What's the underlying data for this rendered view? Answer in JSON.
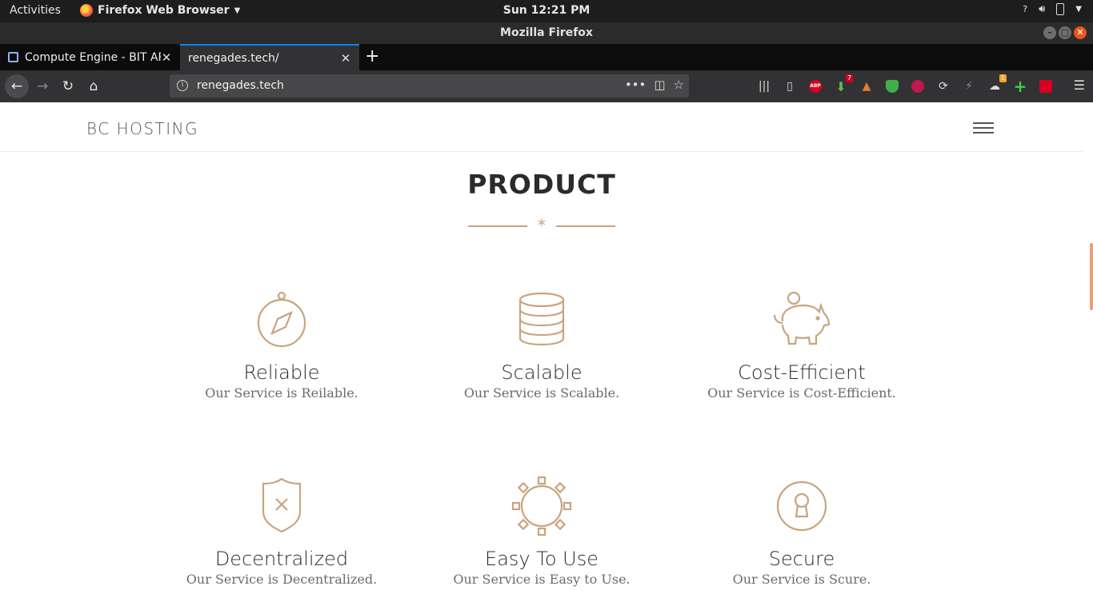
{
  "system_bar": {
    "activities": "Activities",
    "app_name": "Firefox Web Browser",
    "clock": "Sun 12:21 PM"
  },
  "window": {
    "title": "Mozilla Firefox"
  },
  "tabs": [
    {
      "label": "Compute Engine - BIT API",
      "active": false
    },
    {
      "label": "renegades.tech/",
      "active": true
    }
  ],
  "navbar": {
    "url": "renegades.tech"
  },
  "extensions": [
    {
      "name": "library-icon"
    },
    {
      "name": "sidebar-icon"
    },
    {
      "name": "adblock-icon",
      "text": "ABP"
    },
    {
      "name": "download-icon",
      "badge": "7"
    },
    {
      "name": "fox-icon"
    },
    {
      "name": "shield-icon"
    },
    {
      "name": "blocker-icon"
    },
    {
      "name": "sync-icon"
    },
    {
      "name": "extension-icon"
    },
    {
      "name": "cloud-icon",
      "badge": "1"
    },
    {
      "name": "plus-icon"
    },
    {
      "name": "flash-icon"
    }
  ],
  "site": {
    "logo": "BC HOSTING",
    "section_title": "PRODUCT",
    "divider_symbol": "*",
    "accent_color": "#c9a47e",
    "features": [
      {
        "icon": "compass-icon",
        "title": "Reliable",
        "desc": "Our Service is Reilable."
      },
      {
        "icon": "database-icon",
        "title": "Scalable",
        "desc": "Our Service is Scalable."
      },
      {
        "icon": "piggy-bank-icon",
        "title": "Cost-Efficient",
        "desc": "Our Service is Cost-Efficient."
      },
      {
        "icon": "shield-x-icon",
        "title": "Decentralized",
        "desc": "Our Service is Decentralized."
      },
      {
        "icon": "gear-icon",
        "title": "Easy To Use",
        "desc": "Our Service is Easy to Use."
      },
      {
        "icon": "keyhole-icon",
        "title": "Secure",
        "desc": "Our Service is Scure."
      }
    ]
  }
}
